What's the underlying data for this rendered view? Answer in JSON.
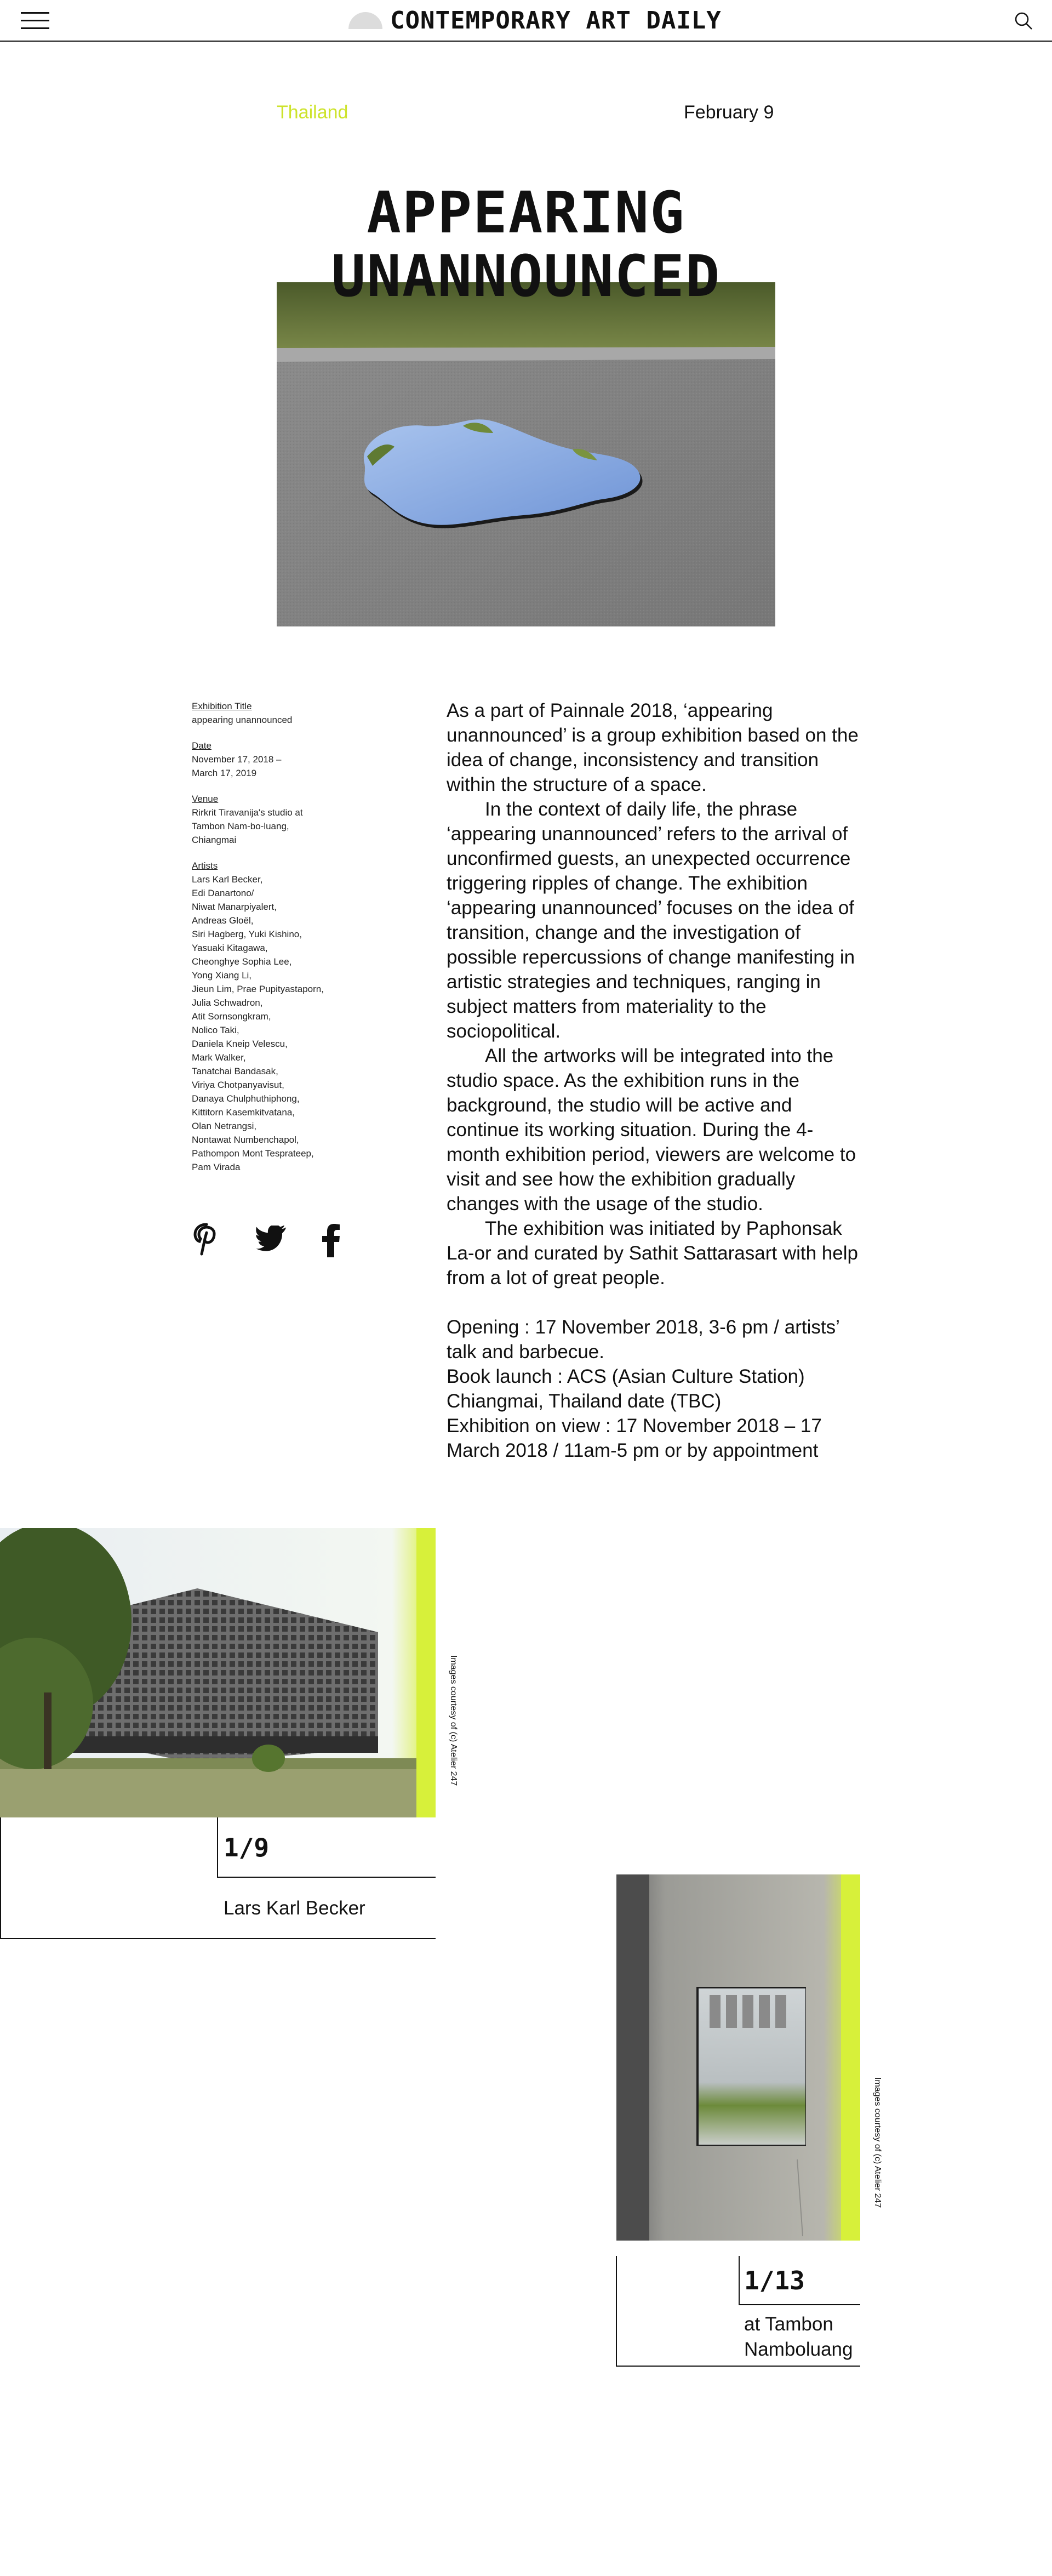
{
  "header": {
    "logo_text": "CONTEMPORARY ART DAILY",
    "menu_icon": "hamburger-menu-icon",
    "search_icon": "search-icon"
  },
  "meta": {
    "country": "Thailand",
    "date": "February 9"
  },
  "title_lines": [
    "APPEARING",
    "UNANNOUNCED"
  ],
  "colors": {
    "accent": "#cde32b",
    "text": "#111111",
    "background": "#ffffff"
  },
  "sidebar": {
    "exhibition_title_label": "Exhibition Title",
    "exhibition_title": "appearing unannounced",
    "date_label": "Date",
    "date_value": "November 17, 2018 –\nMarch 17, 2019",
    "venue_label": "Venue",
    "venue_value": "Rirkrit Tiravanija's studio at\nTambon Nam-bo-luang,\nChiangmai",
    "artists_label": "Artists",
    "artists_value": "Lars Karl Becker,\nEdi Danartono/\nNiwat Manarpiyalert,\nAndreas Gloël,\nSiri Hagberg, Yuki Kishino,\nYasuaki Kitagawa,\nCheonghye Sophia Lee,\nYong Xiang Li,\nJieun Lim, Prae Pupityastaporn,\nJulia Schwadron,\nAtit Sornsongkram,\nNolico Taki,\nDaniela Kneip Velescu,\nMark Walker,\nTanatchai Bandasak,\nViriya Chotpanyavisut,\nDanaya Chulphuthiphong,\nKittitorn Kasemkitvatana,\nOlan Netrangsi,\nNontawat Numbenchapol,\nPathompon Mont Tesprateep,\nPam Virada"
  },
  "social": {
    "pinterest_icon": "pinterest-icon",
    "twitter_icon": "twitter-icon",
    "facebook_icon": "facebook-icon"
  },
  "body": {
    "p1": "As a part of Painnale 2018, ‘appearing unannounced’ is a group exhibition based on the idea of change, inconsistency and transition within the structure of a space.",
    "p2": "In the context of daily life, the phrase ‘appearing unannounced’ refers to the arrival of unconfirmed guests, an unexpected occurrence triggering ripples of change. The exhibition ‘appearing unannounced’ focuses on the idea of transition, change and the investigation of possible repercussions of change manifesting in artistic strategies and techniques, ranging in subject matters from materiality to the sociopolitical.",
    "p3": "All the artworks will be integrated into the studio space. As the exhibition runs in the background, the studio will be active and continue its working situation. During the 4-month exhibition period, viewers are welcome to visit and see how the exhibition gradually changes with the usage of the studio.",
    "p4": "The exhibition was initiated by Paphonsak La-or and curated by Sathit Sattarasart with help from a lot of great people.",
    "p5": "Opening : 17 November 2018, 3-6 pm / artists’ talk and barbecue.",
    "p6": "Book launch : ACS (Asian Culture Station) Chiangmai, Thailand date (TBC)",
    "p7": "Exhibition on view : 17 November 2018 – 17 March 2018 / 11am-5 pm or by appointment"
  },
  "gallery": [
    {
      "counter": "1/9",
      "caption": "Lars Karl Becker",
      "credit": "Images courtesy of (c) Atelier 247"
    },
    {
      "counter": "1/13",
      "caption": "at Tambon\nNamboluang",
      "credit": "Images courtesy of (c) Atelier 247"
    }
  ]
}
